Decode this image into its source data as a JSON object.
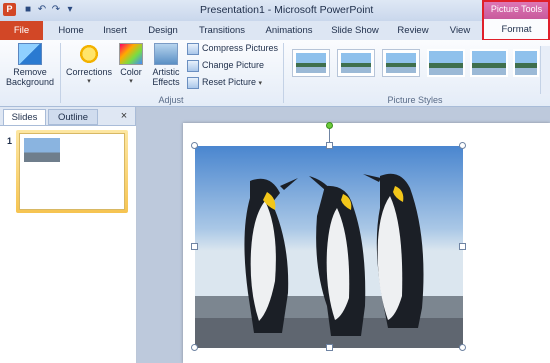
{
  "title_bar": {
    "app_icon_letter": "P",
    "title": "Presentation1 - Microsoft PowerPoint",
    "context_group": "Picture Tools",
    "quick_access": [
      "save-icon",
      "undo-icon",
      "redo-icon",
      "customize-icon"
    ]
  },
  "tabs": [
    {
      "label": "File"
    },
    {
      "label": "Home"
    },
    {
      "label": "Insert"
    },
    {
      "label": "Design"
    },
    {
      "label": "Transitions"
    },
    {
      "label": "Animations"
    },
    {
      "label": "Slide Show"
    },
    {
      "label": "Review"
    },
    {
      "label": "View"
    },
    {
      "label": "Format"
    }
  ],
  "ribbon": {
    "remove_background": {
      "line1": "Remove",
      "line2": "Background"
    },
    "corrections": "Corrections",
    "color": "Color",
    "artistic_effects": {
      "line1": "Artistic",
      "line2": "Effects"
    },
    "compress_pictures": "Compress Pictures",
    "change_picture": "Change Picture",
    "reset_picture": "Reset Picture",
    "adjust_group": "Adjust",
    "picture_styles_group": "Picture Styles"
  },
  "left_pane": {
    "tab_slides": "Slides",
    "tab_outline": "Outline",
    "close": "×",
    "slide_number": "1"
  },
  "colors": {
    "file_tab": "#d24726",
    "context_tab": "#c85a9c",
    "highlight": "#e0202a"
  }
}
